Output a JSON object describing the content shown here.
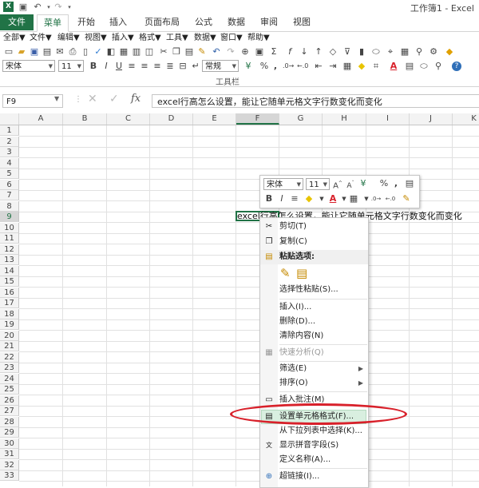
{
  "title_bar": {
    "title": "工作簿1 - Excel",
    "app_icon": "X"
  },
  "tabs": [
    {
      "label": "文件"
    },
    {
      "label": "菜单"
    },
    {
      "label": "开始"
    },
    {
      "label": "插入"
    },
    {
      "label": "页面布局"
    },
    {
      "label": "公式"
    },
    {
      "label": "数据"
    },
    {
      "label": "审阅"
    },
    {
      "label": "视图"
    }
  ],
  "menu_row": [
    {
      "label": "全部▼"
    },
    {
      "label": "文件▼"
    },
    {
      "label": "编辑▼"
    },
    {
      "label": "视图▼"
    },
    {
      "label": "插入▼"
    },
    {
      "label": "格式▼"
    },
    {
      "label": "工具▼"
    },
    {
      "label": "数据▼"
    },
    {
      "label": "窗口▼"
    },
    {
      "label": "帮助▼"
    }
  ],
  "toolbar": {
    "font_name": "宋体",
    "font_size": "11",
    "number_format": "常规",
    "group_label": "工具栏",
    "bold": "B",
    "italic": "I",
    "underline": "U",
    "percent": "%",
    "comma": ","
  },
  "formula_bar": {
    "name_box": "F9",
    "fx": "fx",
    "content": "excel行高怎么设置，能让它随单元格文字行数变化而变化"
  },
  "columns": [
    "A",
    "B",
    "C",
    "D",
    "E",
    "F",
    "G",
    "H",
    "I",
    "J",
    "K"
  ],
  "rows": [
    "1",
    "2",
    "3",
    "4",
    "5",
    "6",
    "7",
    "8",
    "9",
    "10",
    "11",
    "12",
    "13",
    "14",
    "15",
    "16",
    "17",
    "18",
    "19",
    "20",
    "21",
    "22",
    "23",
    "24",
    "25",
    "26",
    "27",
    "28",
    "29",
    "30",
    "31",
    "32",
    "33"
  ],
  "cell_f9_text": "excel行高怎么设置，能让它随单元格文字行数变化而变化",
  "mini_toolbar": {
    "font_name": "宋体",
    "font_size": "11",
    "bold": "B",
    "italic": "I",
    "percent": "%",
    "comma": ","
  },
  "context_menu": {
    "cut": "剪切(T)",
    "copy": "复制(C)",
    "paste_options": "粘贴选项:",
    "paste_special": "选择性粘贴(S)...",
    "insert": "插入(I)...",
    "delete": "删除(D)...",
    "clear": "清除内容(N)",
    "quick_analysis": "快速分析(Q)",
    "filter": "筛选(E)",
    "sort": "排序(O)",
    "insert_comment": "插入批注(M)",
    "format_cells": "设置单元格格式(F)...",
    "pick_from_list": "从下拉列表中选择(K)...",
    "phonetic": "显示拼音字段(S)",
    "define_name": "定义名称(A)...",
    "hyperlink": "超链接(I)..."
  },
  "colors": {
    "excel_green": "#217346",
    "highlight_oval": "#d8202a"
  }
}
